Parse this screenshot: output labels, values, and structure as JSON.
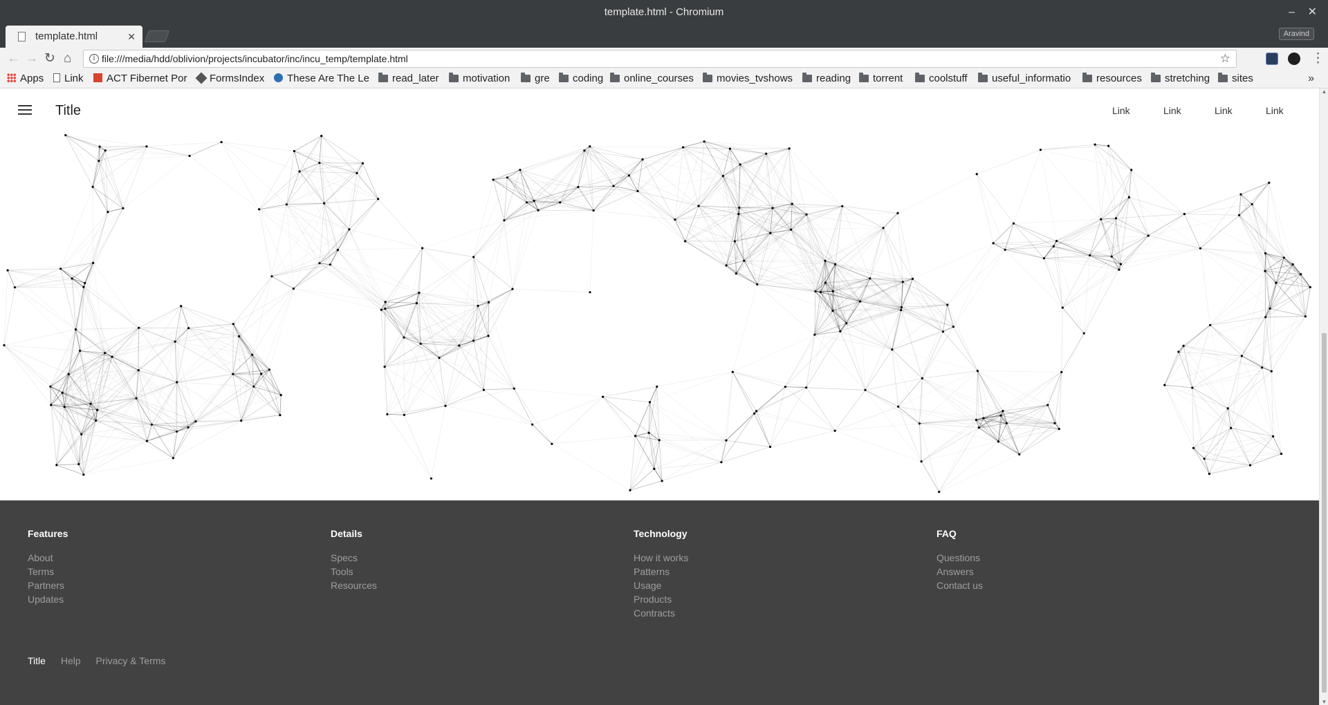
{
  "window": {
    "title": "template.html - Chromium",
    "controls": {
      "minimize": "–",
      "close": "✕"
    }
  },
  "tab": {
    "title": "template.html",
    "close": "✕"
  },
  "profile": "Aravind",
  "toolbar": {
    "back": "←",
    "forward": "→",
    "reload": "↻",
    "home": "⌂",
    "url": "file:///media/hdd/oblivion/projects/incubator/inc/incu_temp/template.html",
    "star": "☆",
    "menu": "⋮"
  },
  "bookmarks": {
    "items": [
      {
        "label": "Apps",
        "icon": "apps-grid-icon"
      },
      {
        "label": "Link",
        "icon": "page-icon"
      },
      {
        "label": "ACT Fibernet Por",
        "icon": "act-favicon-icon"
      },
      {
        "label": "FormsIndex",
        "icon": "formsindex-favicon-icon"
      },
      {
        "label": "These Are The Le",
        "icon": "site-favicon-icon"
      },
      {
        "label": "read_later",
        "icon": "folder-icon"
      },
      {
        "label": "motivation",
        "icon": "folder-icon"
      },
      {
        "label": "gre",
        "icon": "folder-icon"
      },
      {
        "label": "coding",
        "icon": "folder-icon"
      },
      {
        "label": "online_courses",
        "icon": "folder-icon"
      },
      {
        "label": "movies_tvshows",
        "icon": "folder-icon"
      },
      {
        "label": "reading",
        "icon": "folder-icon"
      },
      {
        "label": "torrent",
        "icon": "folder-icon"
      },
      {
        "label": "coolstuff",
        "icon": "folder-icon"
      },
      {
        "label": "useful_informatio",
        "icon": "folder-icon"
      },
      {
        "label": "resources",
        "icon": "folder-icon"
      },
      {
        "label": "stretching",
        "icon": "folder-icon"
      },
      {
        "label": "sites",
        "icon": "folder-icon"
      }
    ],
    "overflow": "»"
  },
  "appbar": {
    "title": "Title",
    "links": [
      "Link",
      "Link",
      "Link",
      "Link"
    ]
  },
  "footer": {
    "columns": [
      {
        "heading": "Features",
        "links": [
          "About",
          "Terms",
          "Partners",
          "Updates"
        ]
      },
      {
        "heading": "Details",
        "links": [
          "Specs",
          "Tools",
          "Resources"
        ]
      },
      {
        "heading": "Technology",
        "links": [
          "How it works",
          "Patterns",
          "Usage",
          "Products",
          "Contracts"
        ]
      },
      {
        "heading": "FAQ",
        "links": [
          "Questions",
          "Answers",
          "Contact us"
        ]
      }
    ],
    "bottom": {
      "title": "Title",
      "links": [
        "Help",
        "Privacy & Terms"
      ]
    }
  },
  "colors": {
    "chrome_dark": "#3a3d3f",
    "chrome_light": "#f2f2f2",
    "footer_bg": "#424242",
    "footer_heading": "#ffffff",
    "footer_link": "#9e9e9e",
    "network_stroke": "#000000"
  }
}
